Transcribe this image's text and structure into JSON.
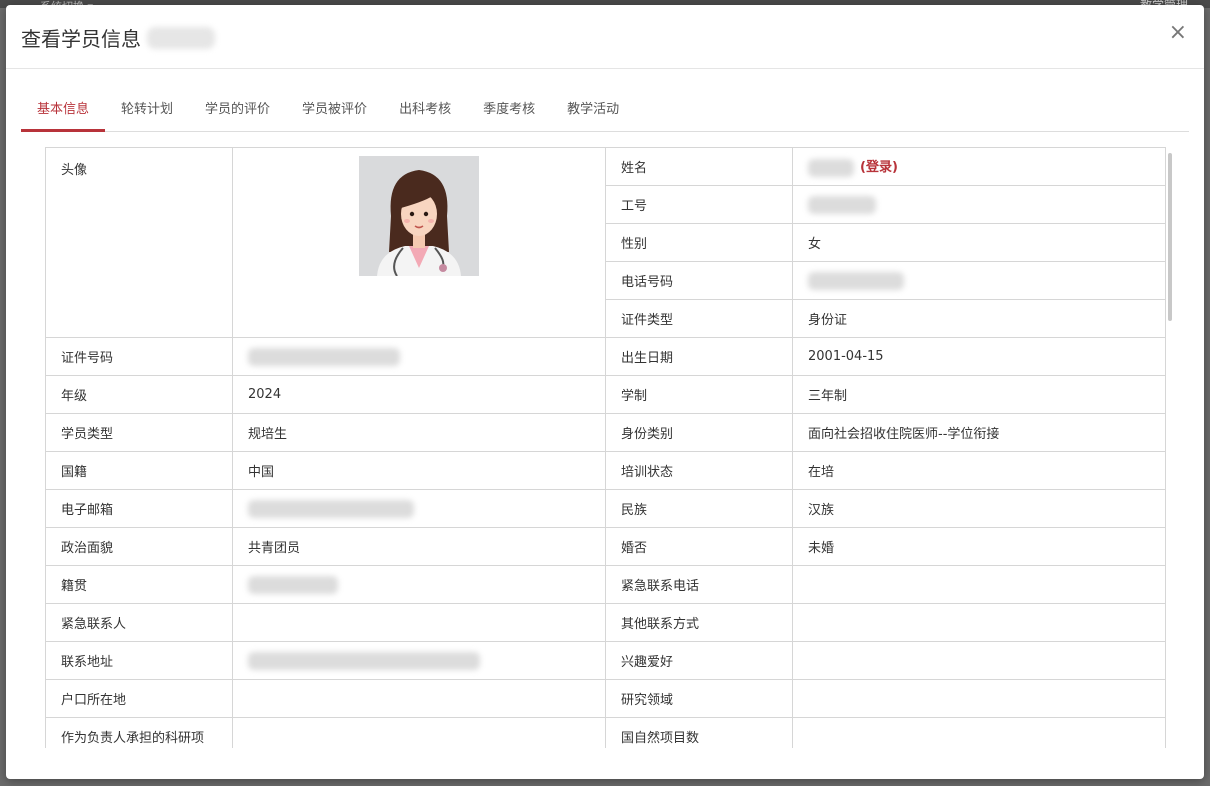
{
  "background": {
    "left_text": "系统切换 ▾",
    "right_text": "教学管理"
  },
  "modal": {
    "title": "查看学员信息",
    "close_symbol": "×"
  },
  "tabs": [
    {
      "label": "基本信息",
      "active": true
    },
    {
      "label": "轮转计划",
      "active": false
    },
    {
      "label": "学员的评价",
      "active": false
    },
    {
      "label": "学员被评价",
      "active": false
    },
    {
      "label": "出科考核",
      "active": false
    },
    {
      "label": "季度考核",
      "active": false
    },
    {
      "label": "教学活动",
      "active": false
    }
  ],
  "colors": {
    "accent": "#b8333a",
    "border": "#d6d6d6"
  },
  "info": {
    "avatar_label": "头像",
    "avatar_icon": "female-doctor-avatar-icon",
    "name_label": "姓名",
    "login_link": "(登录)",
    "job_no_label": "工号",
    "gender_label": "性别",
    "gender_value": "女",
    "phone_label": "电话号码",
    "id_type_label": "证件类型",
    "id_type_value": "身份证",
    "id_no_label": "证件号码",
    "birth_label": "出生日期",
    "birth_value": "2001-04-15",
    "grade_label": "年级",
    "grade_value": "2024",
    "school_system_label": "学制",
    "school_system_value": "三年制",
    "student_type_label": "学员类型",
    "student_type_value": "规培生",
    "identity_label": "身份类别",
    "identity_value": "面向社会招收住院医师--学位衔接",
    "nationality_label": "国籍",
    "nationality_value": "中国",
    "training_status_label": "培训状态",
    "training_status_value": "在培",
    "email_label": "电子邮箱",
    "ethnicity_label": "民族",
    "ethnicity_value": "汉族",
    "political_label": "政治面貌",
    "political_value": "共青团员",
    "marital_label": "婚否",
    "marital_value": "未婚",
    "native_place_label": "籍贯",
    "emergency_phone_label": "紧急联系电话",
    "emergency_contact_label": "紧急联系人",
    "other_contact_label": "其他联系方式",
    "address_label": "联系地址",
    "hobby_label": "兴趣爱好",
    "household_label": "户口所在地",
    "research_label": "研究领域",
    "research_projects_label": "作为负责人承担的科研项",
    "nsfc_label": "国自然项目数"
  }
}
